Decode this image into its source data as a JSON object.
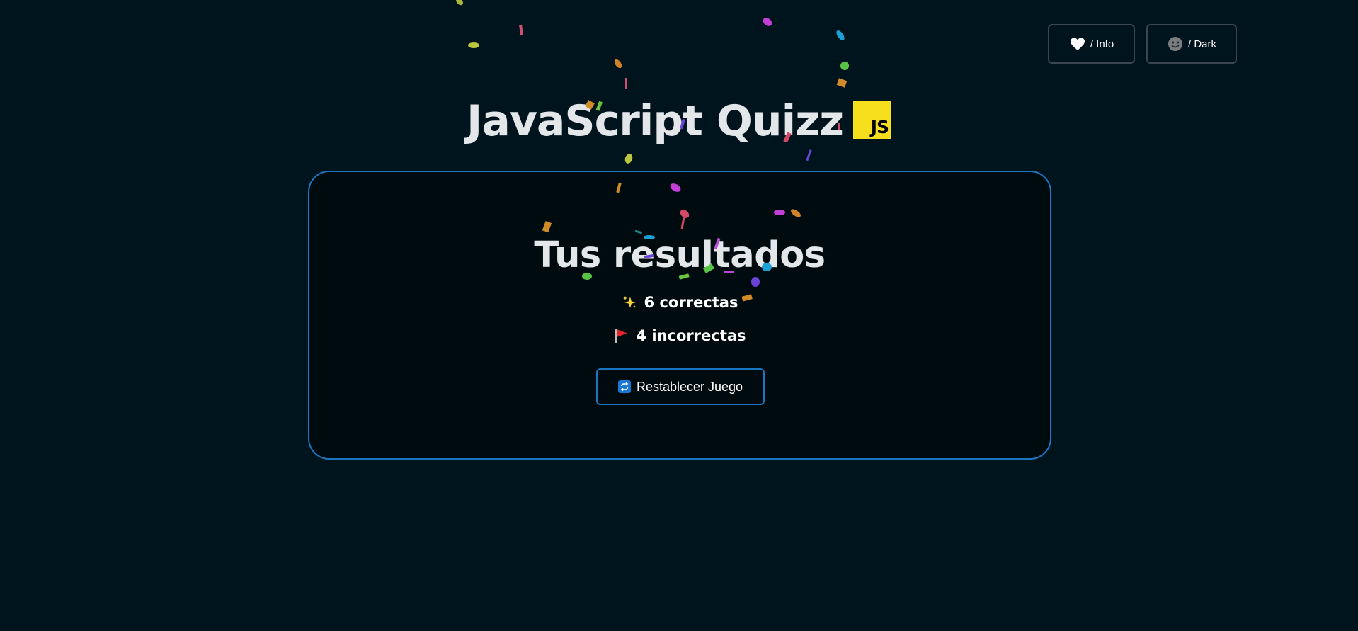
{
  "header": {
    "info_label": "/ Info",
    "dark_label": "/ Dark",
    "info_icon": "heart-icon",
    "dark_icon": "smiley-face-icon"
  },
  "title": {
    "text": "JavaScript Quizz",
    "logo_text": "JS",
    "logo_color": "#f7df1e"
  },
  "results": {
    "heading": "Tus resultados",
    "correct_label": "6 correctas",
    "correct_icon": "sparkles-icon",
    "incorrect_label": "4 incorrectas",
    "incorrect_icon": "red-flag-icon"
  },
  "reset": {
    "label": "Restablecer Juego",
    "icon": "repeat-icon"
  },
  "colors": {
    "background": "#00141e",
    "accent": "#1b76c2",
    "card_background": "#000b10"
  }
}
